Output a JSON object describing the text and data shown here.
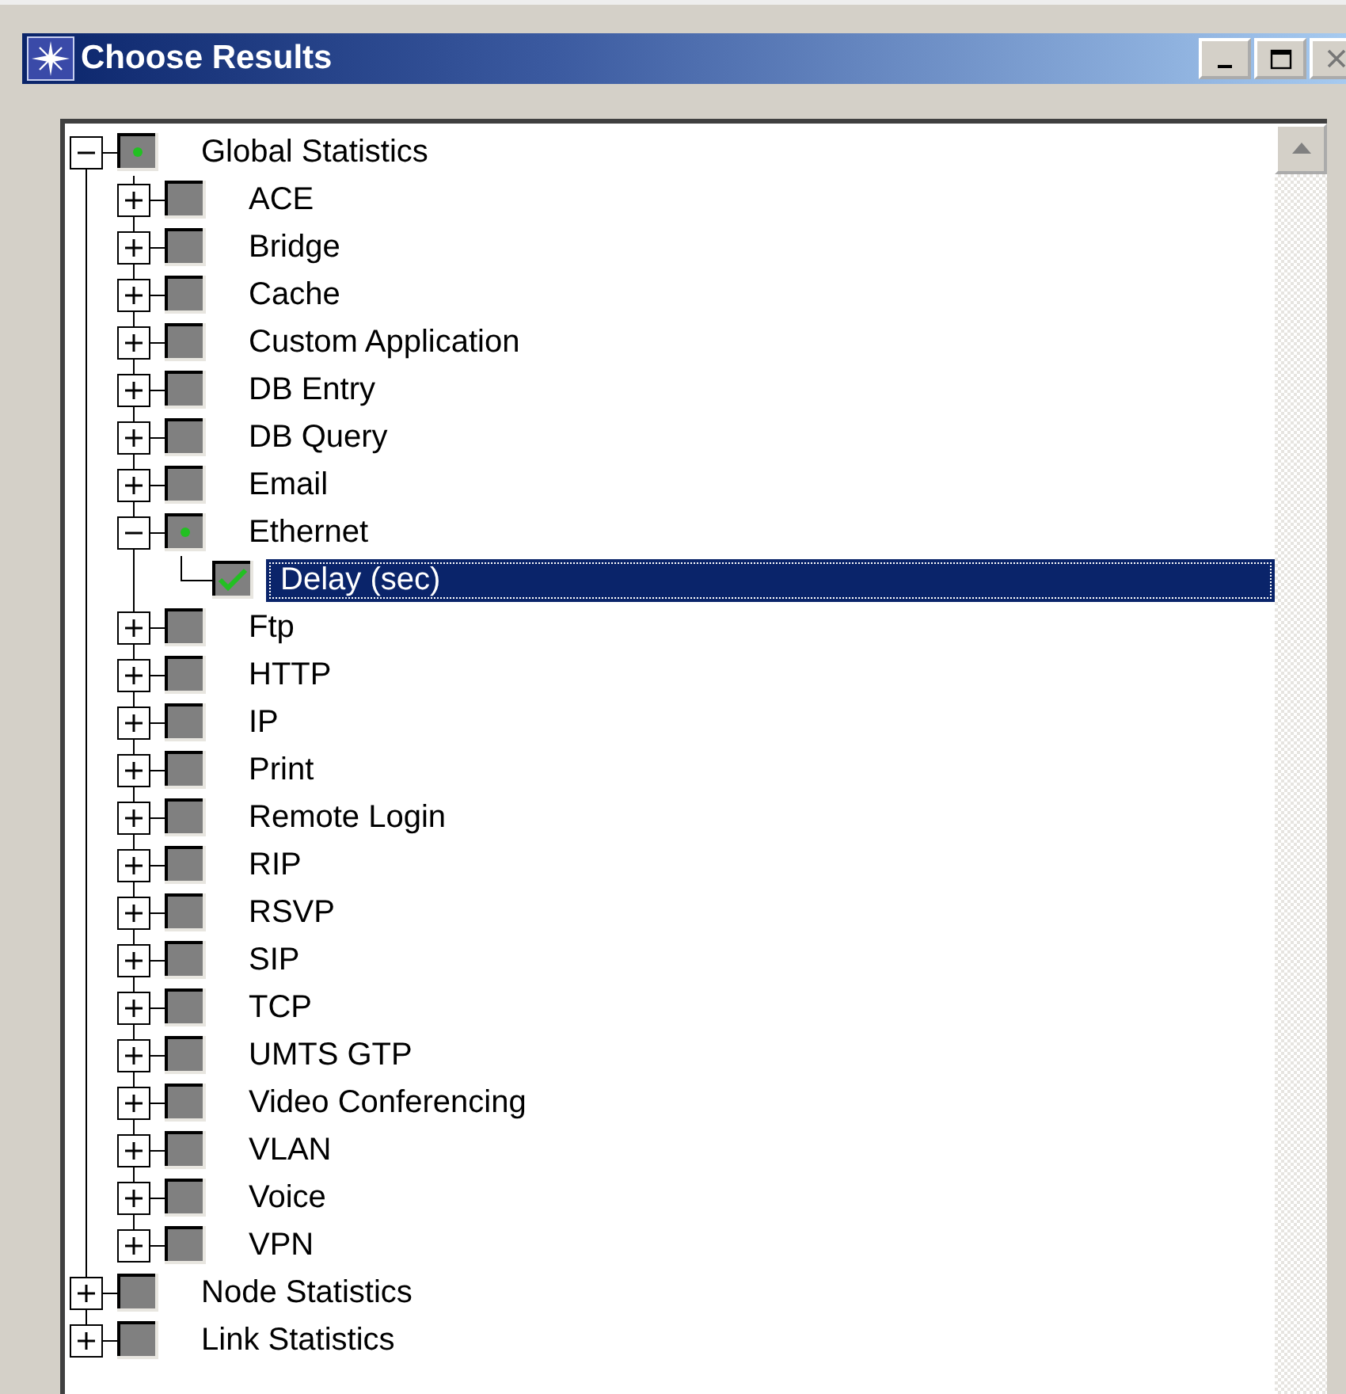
{
  "window": {
    "title": "Choose Results"
  },
  "tree": {
    "items": [
      {
        "label": "Global Statistics",
        "expanded": true,
        "checked": false,
        "partial": true,
        "selected": false,
        "children": [
          {
            "label": "ACE",
            "expanded": false,
            "checked": false,
            "partial": false,
            "selected": false
          },
          {
            "label": "Bridge",
            "expanded": false,
            "checked": false,
            "partial": false,
            "selected": false
          },
          {
            "label": "Cache",
            "expanded": false,
            "checked": false,
            "partial": false,
            "selected": false
          },
          {
            "label": "Custom Application",
            "expanded": false,
            "checked": false,
            "partial": false,
            "selected": false
          },
          {
            "label": "DB Entry",
            "expanded": false,
            "checked": false,
            "partial": false,
            "selected": false
          },
          {
            "label": "DB Query",
            "expanded": false,
            "checked": false,
            "partial": false,
            "selected": false
          },
          {
            "label": "Email",
            "expanded": false,
            "checked": false,
            "partial": false,
            "selected": false
          },
          {
            "label": "Ethernet",
            "expanded": true,
            "checked": false,
            "partial": true,
            "selected": false,
            "children": [
              {
                "label": "Delay (sec)",
                "checked": true,
                "partial": false,
                "selected": true
              }
            ]
          },
          {
            "label": "Ftp",
            "expanded": false,
            "checked": false,
            "partial": false,
            "selected": false
          },
          {
            "label": "HTTP",
            "expanded": false,
            "checked": false,
            "partial": false,
            "selected": false
          },
          {
            "label": "IP",
            "expanded": false,
            "checked": false,
            "partial": false,
            "selected": false
          },
          {
            "label": "Print",
            "expanded": false,
            "checked": false,
            "partial": false,
            "selected": false
          },
          {
            "label": "Remote Login",
            "expanded": false,
            "checked": false,
            "partial": false,
            "selected": false
          },
          {
            "label": "RIP",
            "expanded": false,
            "checked": false,
            "partial": false,
            "selected": false
          },
          {
            "label": "RSVP",
            "expanded": false,
            "checked": false,
            "partial": false,
            "selected": false
          },
          {
            "label": "SIP",
            "expanded": false,
            "checked": false,
            "partial": false,
            "selected": false
          },
          {
            "label": "TCP",
            "expanded": false,
            "checked": false,
            "partial": false,
            "selected": false
          },
          {
            "label": "UMTS GTP",
            "expanded": false,
            "checked": false,
            "partial": false,
            "selected": false
          },
          {
            "label": "Video Conferencing",
            "expanded": false,
            "checked": false,
            "partial": false,
            "selected": false
          },
          {
            "label": "VLAN",
            "expanded": false,
            "checked": false,
            "partial": false,
            "selected": false
          },
          {
            "label": "Voice",
            "expanded": false,
            "checked": false,
            "partial": false,
            "selected": false
          },
          {
            "label": "VPN",
            "expanded": false,
            "checked": false,
            "partial": false,
            "selected": false
          }
        ]
      },
      {
        "label": "Node Statistics",
        "expanded": false,
        "checked": false,
        "partial": false,
        "selected": false
      },
      {
        "label": "Link Statistics",
        "expanded": false,
        "checked": false,
        "partial": false,
        "selected": false
      }
    ]
  }
}
